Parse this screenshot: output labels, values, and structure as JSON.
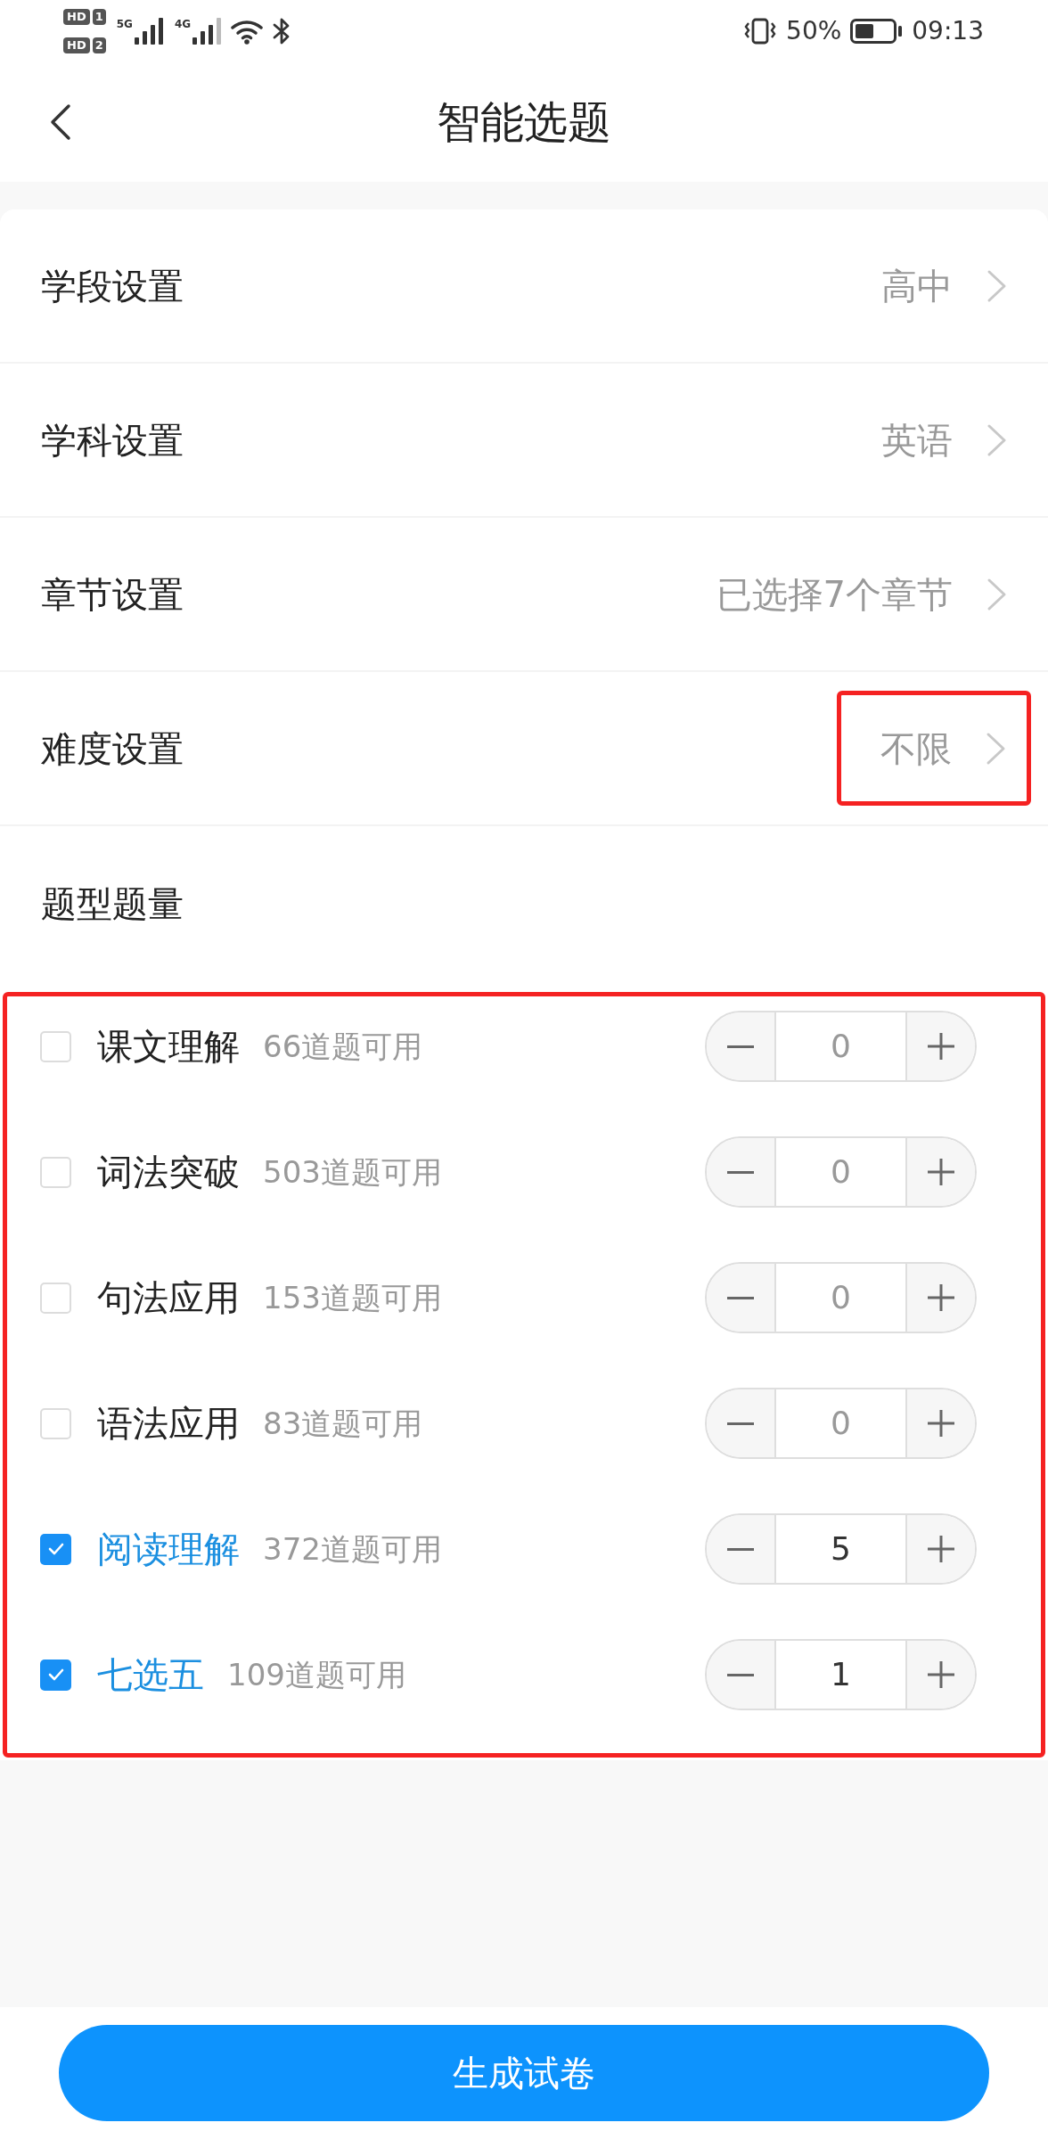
{
  "status_bar": {
    "sim_slots": [
      {
        "badge": "HD",
        "slot": "1"
      },
      {
        "badge": "HD",
        "slot": "2"
      }
    ],
    "signals": [
      {
        "label": "5G"
      },
      {
        "label": "4G"
      }
    ],
    "battery": "50%",
    "time": "09:13"
  },
  "header": {
    "title": "智能选题"
  },
  "settings": [
    {
      "label": "学段设置",
      "value": "高中",
      "highlighted": false
    },
    {
      "label": "学科设置",
      "value": "英语",
      "highlighted": false
    },
    {
      "label": "章节设置",
      "value": "已选择7个章节",
      "highlighted": false
    },
    {
      "label": "难度设置",
      "value": "不限",
      "highlighted": true
    }
  ],
  "question_types": {
    "title": "题型题量",
    "highlighted": true,
    "items": [
      {
        "name": "课文理解",
        "available": "66道题可用",
        "checked": false,
        "count": "0"
      },
      {
        "name": "词法突破",
        "available": "503道题可用",
        "checked": false,
        "count": "0"
      },
      {
        "name": "句法应用",
        "available": "153道题可用",
        "checked": false,
        "count": "0"
      },
      {
        "name": "语法应用",
        "available": "83道题可用",
        "checked": false,
        "count": "0"
      },
      {
        "name": "阅读理解",
        "available": "372道题可用",
        "checked": true,
        "count": "5"
      },
      {
        "name": "七选五",
        "available": "109道题可用",
        "checked": true,
        "count": "1"
      }
    ]
  },
  "generate_button": "生成试卷"
}
